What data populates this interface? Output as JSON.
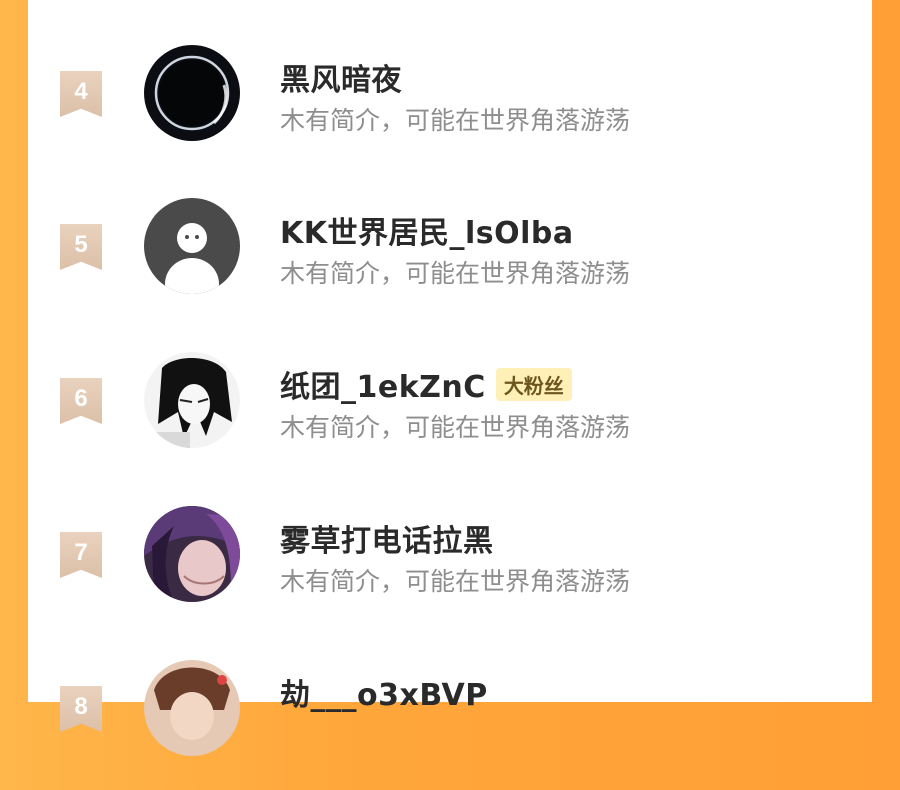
{
  "ranking_list": {
    "rows": [
      {
        "rank": "4",
        "name": "黑风暗夜",
        "bio": "木有简介，可能在世界角落游荡",
        "badge": ""
      },
      {
        "rank": "5",
        "name": "KK世界居民_lsOlba",
        "bio": "木有简介，可能在世界角落游荡",
        "badge": ""
      },
      {
        "rank": "6",
        "name": "纸团_1ekZnC",
        "bio": "木有简介，可能在世界角落游荡",
        "badge": "大粉丝"
      },
      {
        "rank": "7",
        "name": "雾草打电话拉黑",
        "bio": "木有简介，可能在世界角落游荡",
        "badge": ""
      },
      {
        "rank": "8",
        "name": "劫___o3xBVP",
        "bio": "",
        "badge": ""
      }
    ]
  },
  "colors": {
    "background_orange": "#ffa63a",
    "rank_badge": "#dcc0a8",
    "fan_badge_bg": "#fff0b8",
    "fan_badge_text": "#6d5522",
    "name_text": "#2a2a2a",
    "bio_text": "#8e8e8e"
  }
}
